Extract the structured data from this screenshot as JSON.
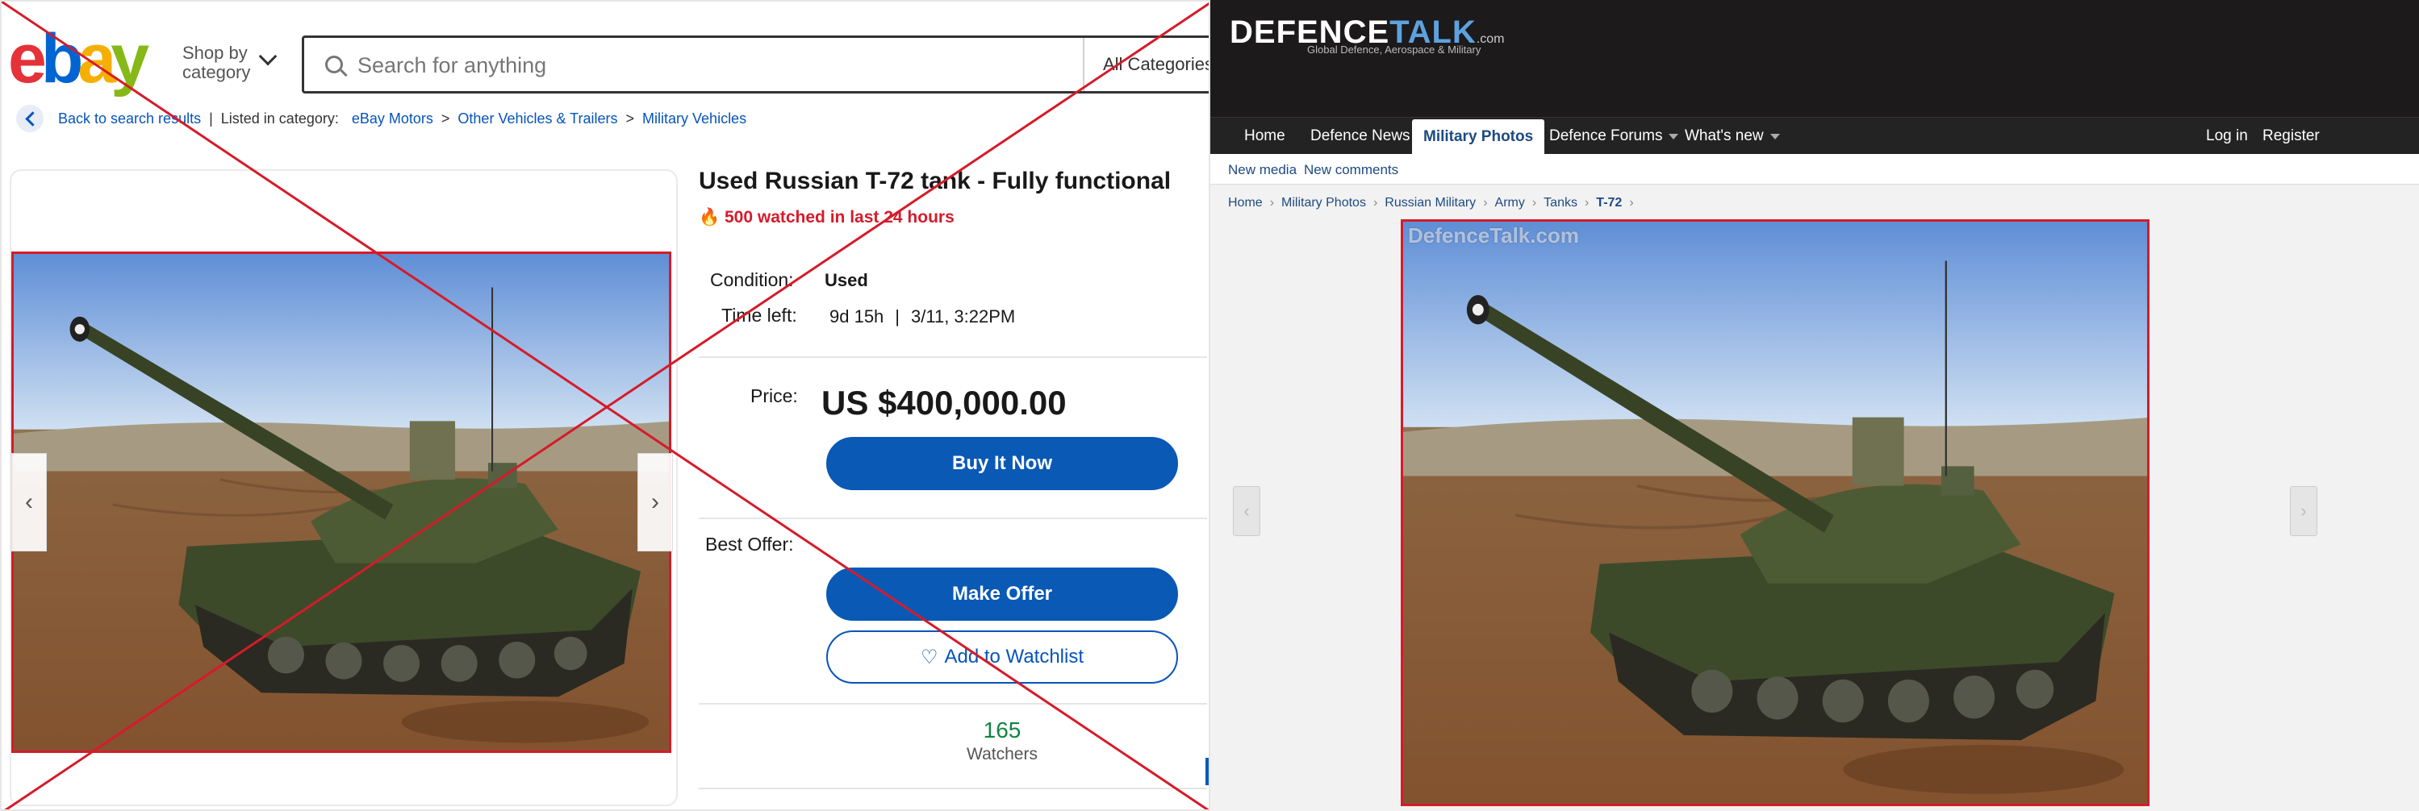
{
  "ebay": {
    "logo": [
      "e",
      "b",
      "a",
      "y"
    ],
    "shop_by": "Shop by",
    "shop_by_category": "category",
    "search_placeholder": "Search for anything",
    "all_categories": "All Categories",
    "back_label": "Back to search results",
    "listed_in": "Listed in category:",
    "crumbs": [
      "eBay Motors",
      "Other Vehicles & Trailers",
      "Military Vehicles"
    ],
    "title": "Used Russian T-72 tank - Fully functional",
    "watched": "500 watched in last 24 hours",
    "condition_label": "Condition:",
    "condition_value": "Used",
    "time_left_label": "Time left:",
    "time_left_value": "9d 15h",
    "time_left_end": "3/11, 3:22PM",
    "price_label": "Price:",
    "price_value": "US $400,000.00",
    "buy_now": "Buy It Now",
    "best_offer_label": "Best Offer:",
    "make_offer": "Make Offer",
    "watchlist": "Add to Watchlist",
    "watchers_count": "165",
    "watchers_label": "Watchers"
  },
  "defencetalk": {
    "logo_a": "DEFENCE",
    "logo_b": "TALK",
    "logo_c": ".com",
    "tagline": "Global Defence, Aerospace & Military",
    "nav": [
      "Home",
      "Defence News",
      "Military Photos",
      "Defence Forums",
      "What's new"
    ],
    "active_tab": "Military Photos",
    "login": "Log in",
    "register": "Register",
    "sub_links": [
      "New media",
      "New comments"
    ],
    "crumbs": [
      "Home",
      "Military Photos",
      "Russian Military",
      "Army",
      "Tanks",
      "T-72"
    ],
    "watermark": "DefenceTalk.com"
  },
  "colors": {
    "cross_red": "#d51b2a",
    "ebay_blue": "#0a59b5",
    "dt_header": "#1c1a1b"
  }
}
